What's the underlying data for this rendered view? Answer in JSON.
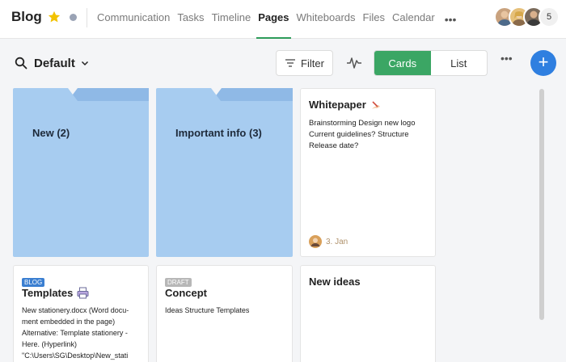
{
  "app": {
    "title": "Blog"
  },
  "nav": {
    "tabs": [
      "Communication",
      "Tasks",
      "Timeline",
      "Pages",
      "Whiteboards",
      "Files",
      "Calendar"
    ],
    "active": "Pages",
    "more": "•••",
    "member_count": "5"
  },
  "toolbar": {
    "view_label": "Default",
    "filter_label": "Filter",
    "view_cards": "Cards",
    "view_list": "List",
    "more": "•••",
    "add": "+"
  },
  "folders": [
    {
      "label": "New (2)"
    },
    {
      "label": "Important info (3)"
    }
  ],
  "cards": {
    "whitepaper": {
      "title": "Whitepaper",
      "lines": [
        "Brainstorming Design new logo",
        "Current guidelines? Structure",
        "Release date?"
      ],
      "date": "3. Jan"
    },
    "templates": {
      "badge": "BLOG",
      "title": "Templates",
      "lines": [
        "New stationery.docx (Word docu-",
        "ment embedded in the page)",
        "Alternative: Template stationery -",
        "Here. (Hyperlink)",
        "\"C:\\Users\\SG\\Desktop\\New_stati"
      ]
    },
    "concept": {
      "badge": "DRAFT",
      "title": "Concept",
      "lines": [
        "Ideas Structure Templates"
      ]
    },
    "new_ideas": {
      "title": "New ideas"
    }
  },
  "colors": {
    "accent_green": "#3ba664",
    "add_blue": "#2f7fe0",
    "folder_blue": "#a7ccf0"
  }
}
